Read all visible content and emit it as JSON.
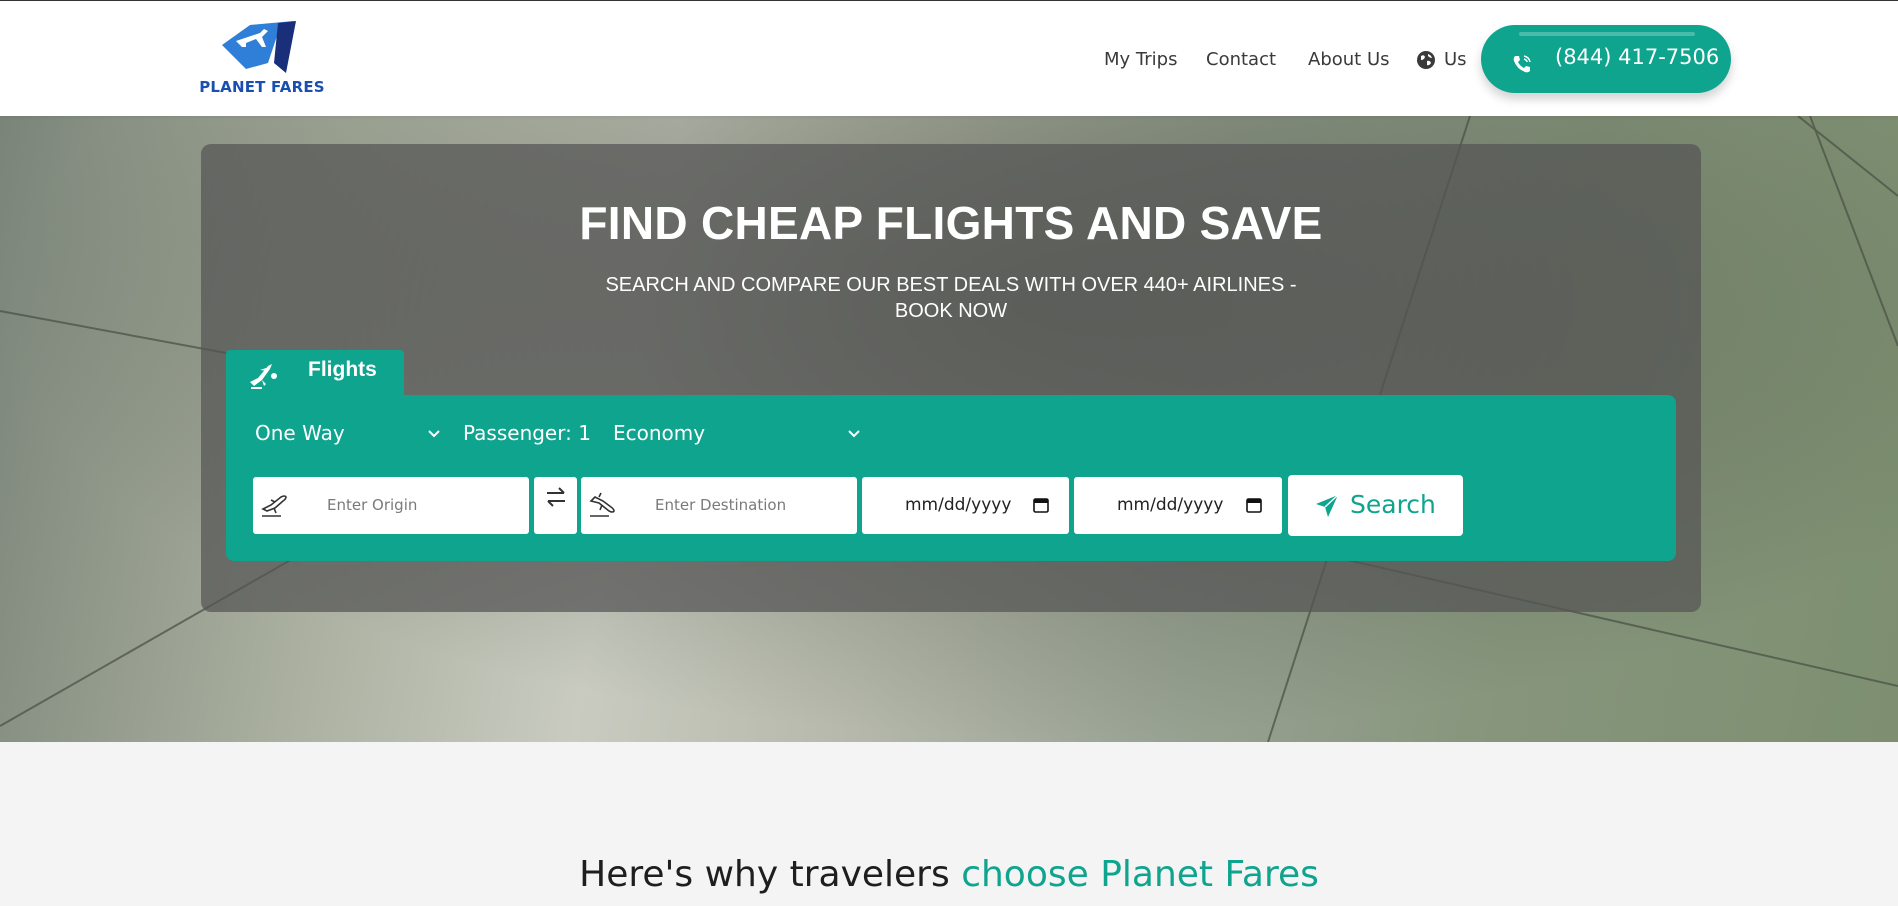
{
  "colors": {
    "accent": "#0ea48e",
    "brand_blue": "#1a4fb0",
    "header_bg": "#ffffff"
  },
  "header": {
    "logo_text": "PLANET FARES",
    "nav": {
      "my_trips": "My Trips",
      "contact": "Contact",
      "about_us": "About Us",
      "language": "Us"
    },
    "phone": "(844) 417-7506",
    "icons": {
      "language": "globe-icon",
      "phone": "phone-icon",
      "logo": "airplane-logo-icon"
    }
  },
  "hero": {
    "title": "FIND CHEAP FLIGHTS AND SAVE",
    "subtitle": "SEARCH AND COMPARE OUR BEST DEALS WITH OVER 440+ AIRLINES - BOOK NOW"
  },
  "search": {
    "tab_label": "Flights",
    "trip_type": "One Way",
    "passengers": "Passenger: 1",
    "cabin_class": "Economy",
    "origin_placeholder": "Enter Origin",
    "destination_placeholder": "Enter Destination",
    "depart_date": "mm/dd/yyyy",
    "return_date": "mm/dd/yyyy",
    "search_label": "Search"
  },
  "why": {
    "lead": "Here's why travelers ",
    "accent": "choose Planet Fares"
  }
}
